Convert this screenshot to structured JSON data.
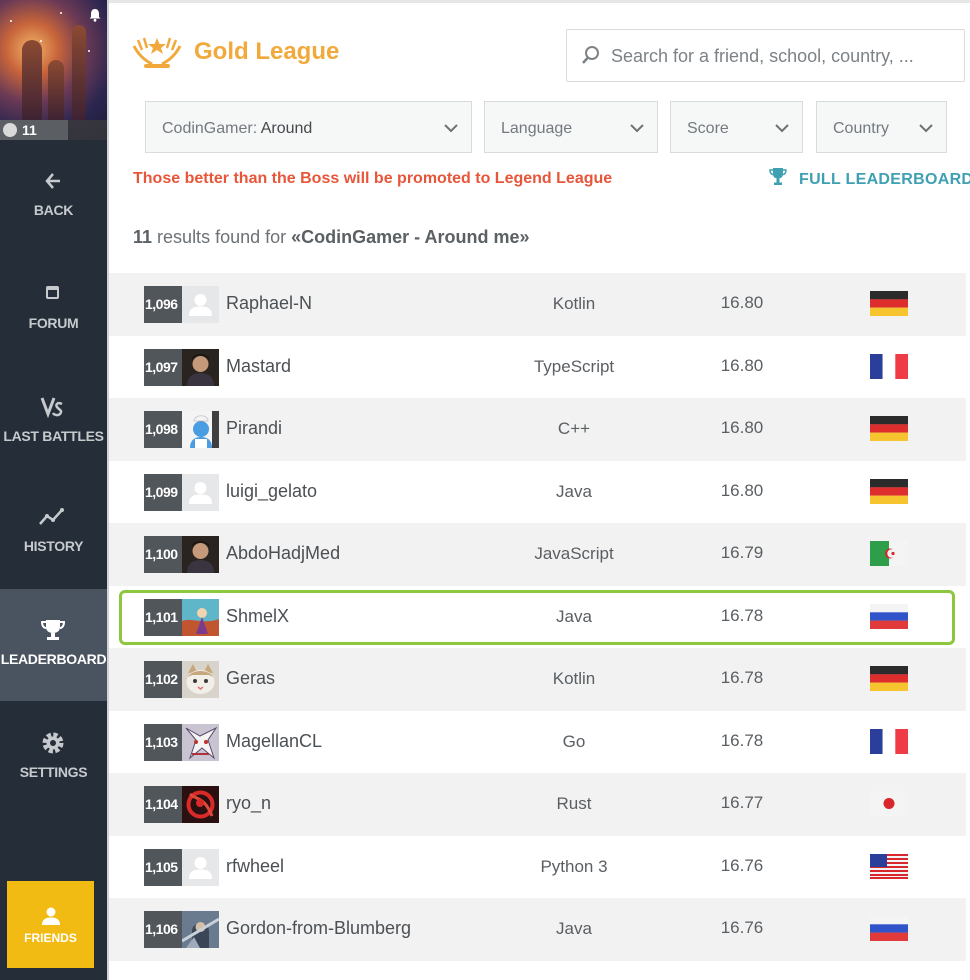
{
  "sidebar": {
    "level": "11",
    "items": [
      {
        "label": "BACK",
        "icon": "arrow-left-icon"
      },
      {
        "label": "FORUM",
        "icon": "forum-icon"
      },
      {
        "label": "LAST BATTLES",
        "icon": "versus-icon"
      },
      {
        "label": "HISTORY",
        "icon": "history-chart-icon"
      },
      {
        "label": "LEADERBOARD",
        "icon": "trophy-icon"
      },
      {
        "label": "SETTINGS",
        "icon": "gear-icon"
      }
    ],
    "active_item": "LEADERBOARD",
    "friends_label": "FRIENDS"
  },
  "header": {
    "league_title": "Gold League",
    "search_placeholder": "Search for a friend, school, country, ..."
  },
  "filters": {
    "codingamer_label": "CodinGamer:",
    "codingamer_value": "Around",
    "language": "Language",
    "score": "Score",
    "country": "Country"
  },
  "promo_text": "Those better than the Boss will be promoted to Legend League",
  "full_leaderboard_label": "FULL LEADERBOARD",
  "results": {
    "count": "11",
    "text": "results found for",
    "query": "«CodinGamer - Around me»"
  },
  "rows": [
    {
      "rank": "1,096",
      "name": "Raphael-N",
      "language": "Kotlin",
      "score": "16.80",
      "country": "Germany",
      "avatar": "default-avatar"
    },
    {
      "rank": "1,097",
      "name": "Mastard",
      "language": "TypeScript",
      "score": "16.80",
      "country": "France",
      "avatar": "photo-avatar"
    },
    {
      "rank": "1,098",
      "name": "Pirandi",
      "language": "C++",
      "score": "16.80",
      "country": "Germany",
      "avatar": "smurf-avatar"
    },
    {
      "rank": "1,099",
      "name": "luigi_gelato",
      "language": "Java",
      "score": "16.80",
      "country": "Germany",
      "avatar": "default-avatar"
    },
    {
      "rank": "1,100",
      "name": "AbdoHadjMed",
      "language": "JavaScript",
      "score": "16.79",
      "country": "Algeria",
      "avatar": "photo-avatar"
    },
    {
      "rank": "1,101",
      "name": "ShmelX",
      "language": "Java",
      "score": "16.78",
      "country": "Russia",
      "avatar": "art-avatar",
      "highlighted": true
    },
    {
      "rank": "1,102",
      "name": "Geras",
      "language": "Kotlin",
      "score": "16.78",
      "country": "Germany",
      "avatar": "cat-avatar"
    },
    {
      "rank": "1,103",
      "name": "MagellanCL",
      "language": "Go",
      "score": "16.78",
      "country": "France",
      "avatar": "anime-avatar"
    },
    {
      "rank": "1,104",
      "name": "ryo_n",
      "language": "Rust",
      "score": "16.77",
      "country": "Japan",
      "avatar": "red-art-avatar"
    },
    {
      "rank": "1,105",
      "name": "rfwheel",
      "language": "Python 3",
      "score": "16.76",
      "country": "United States",
      "avatar": "default-avatar"
    },
    {
      "rank": "1,106",
      "name": "Gordon-from-Blumberg",
      "language": "Java",
      "score": "16.76",
      "country": "Russia",
      "avatar": "knight-avatar"
    }
  ],
  "colors": {
    "sidebar_bg": "#252e38",
    "league_gold": "#f2a93b",
    "promo_red": "#e8563a",
    "link_teal": "#3fa0b3",
    "highlight_green": "#8dc63f",
    "friends_yellow": "#f2bb13"
  }
}
